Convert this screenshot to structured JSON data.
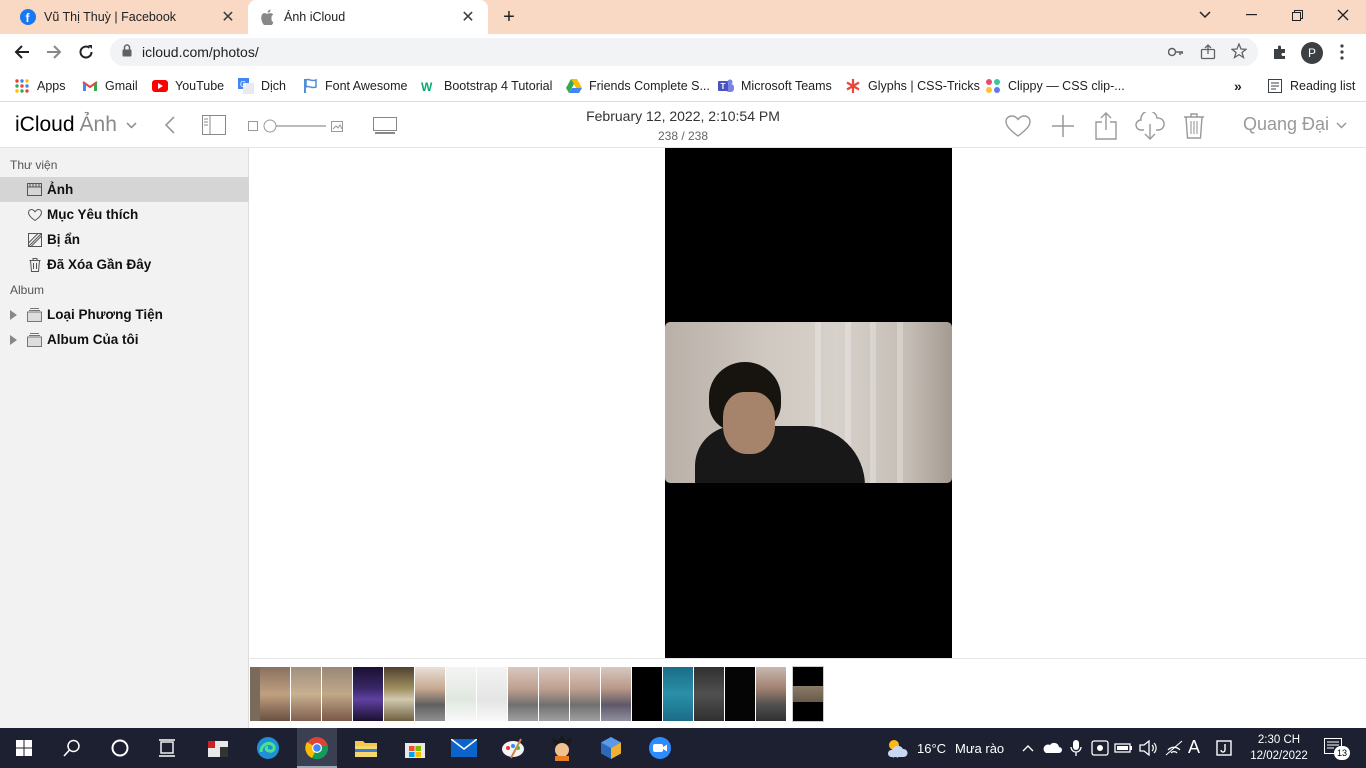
{
  "browser": {
    "tabs": [
      {
        "title": "Vũ Thị Thuỳ | Facebook",
        "icon": "facebook-icon",
        "active": false
      },
      {
        "title": "Ảnh iCloud",
        "icon": "apple-icon",
        "active": true
      }
    ],
    "url": "icloud.com/photos/",
    "profile_initial": "P",
    "bookmarks": [
      {
        "label": "Apps",
        "icon": "apps-grid-icon"
      },
      {
        "label": "Gmail",
        "icon": "gmail-icon"
      },
      {
        "label": "YouTube",
        "icon": "youtube-icon"
      },
      {
        "label": "Dịch",
        "icon": "translate-icon"
      },
      {
        "label": "Font Awesome",
        "icon": "flag-icon"
      },
      {
        "label": "Bootstrap 4 Tutorial",
        "icon": "w3schools-icon"
      },
      {
        "label": "Friends Complete S...",
        "icon": "google-drive-icon"
      },
      {
        "label": "Microsoft Teams",
        "icon": "teams-icon"
      },
      {
        "label": "Glyphs | CSS-Tricks",
        "icon": "asterisk-icon"
      },
      {
        "label": "Clippy — CSS clip-...",
        "icon": "clippy-icon"
      }
    ],
    "reading_list": "Reading list",
    "colors": {
      "tabstrip": "#f9d9c4",
      "omnibox": "#f1f3f4"
    }
  },
  "icloud": {
    "brand": "iCloud",
    "app": "Ảnh",
    "photo_date": "February 12, 2022, 2:10:54 PM",
    "photo_count": "238 / 238",
    "user": "Quang Đại",
    "zoom_level": 0.1
  },
  "sidebar": {
    "library_title": "Thư viện",
    "library_items": [
      {
        "label": "Ảnh",
        "icon": "photos-icon",
        "selected": true
      },
      {
        "label": "Mục Yêu thích",
        "icon": "heart-icon",
        "selected": false
      },
      {
        "label": "Bị ẩn",
        "icon": "hidden-icon",
        "selected": false
      },
      {
        "label": "Đã Xóa Gần Đây",
        "icon": "trash-icon",
        "selected": false
      }
    ],
    "album_title": "Album",
    "album_items": [
      {
        "label": "Loại Phương Tiện",
        "icon": "album-stack-icon"
      },
      {
        "label": "Album Của tôi",
        "icon": "album-stack-icon"
      }
    ]
  },
  "taskbar": {
    "weather_temp": "16°C",
    "weather_text": "Mưa rào",
    "ime": "A",
    "time": "2:30 CH",
    "date": "12/02/2022",
    "notification_count": "13"
  }
}
